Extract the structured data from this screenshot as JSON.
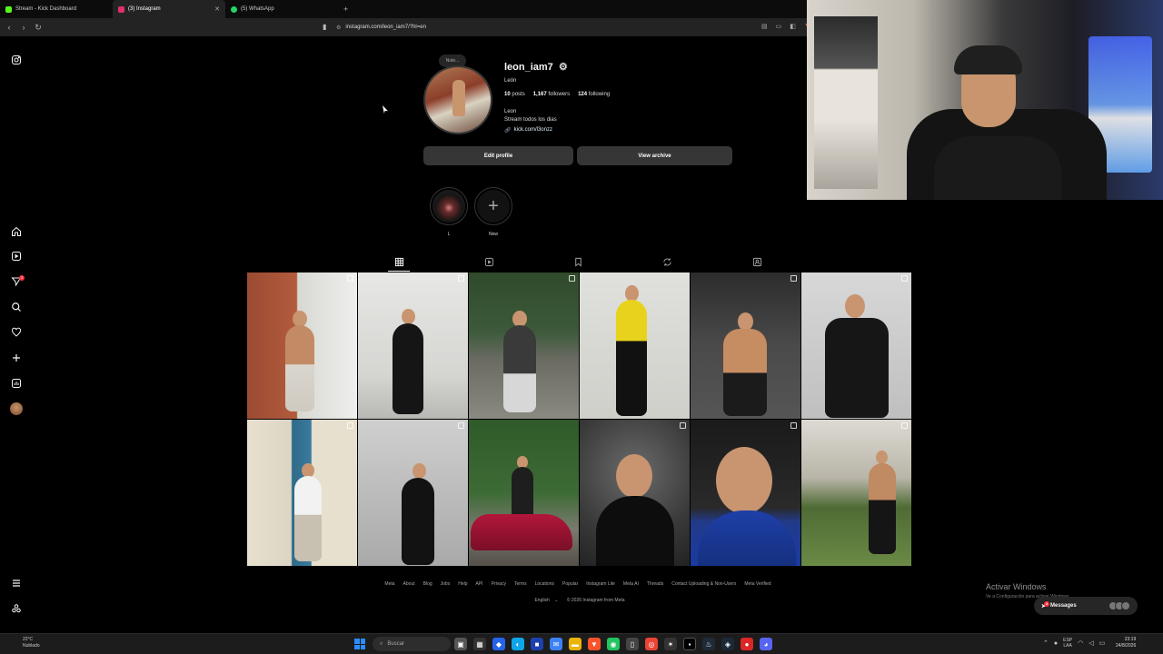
{
  "browser": {
    "tabs": [
      {
        "title": "Stream - Kick Dashboard",
        "color": "#53fc18"
      },
      {
        "title": "(3) Instagram",
        "color": "#e1306c"
      },
      {
        "title": "(5) WhatsApp",
        "color": "#25d366"
      }
    ],
    "url": "instagram.com/leon_iam7/?hl=en"
  },
  "sidebar": {
    "items": [
      "instagram-logo",
      "home",
      "reels",
      "messages",
      "search",
      "notifications",
      "create",
      "dashboard",
      "profile",
      "more",
      "also-from-meta"
    ],
    "messages_badge": "3"
  },
  "profile": {
    "note": "Note...",
    "username": "leon_iam7",
    "fullname": "León",
    "posts": "10",
    "posts_label": "posts",
    "followers": "1,167",
    "followers_label": "followers",
    "following": "124",
    "following_label": "following",
    "bio_name": "Leon",
    "bio_text": "Stream todos los dias",
    "link": "kick.com/l3onzz",
    "edit_button": "Edit profile",
    "archive_button": "View archive"
  },
  "highlights": [
    {
      "label": "L"
    },
    {
      "label": "New"
    }
  ],
  "tabs": [
    "posts",
    "reels",
    "saved",
    "reposts",
    "tagged"
  ],
  "footer": {
    "links": [
      "Meta",
      "About",
      "Blog",
      "Jobs",
      "Help",
      "API",
      "Privacy",
      "Terms",
      "Locations",
      "Popular",
      "Instagram Lite",
      "Meta AI",
      "Threads",
      "Contact Uploading & Non-Users",
      "Meta Verified"
    ],
    "language": "English",
    "copyright": "© 2026 Instagram from Meta"
  },
  "overlay": {
    "activate_title": "Activar Windows",
    "activate_sub": "Ve a Configuración para activar Windows.",
    "messages_label": "Messages",
    "messages_badge": "3"
  },
  "taskbar": {
    "temp": "22°C",
    "weather": "Nublado",
    "search_placeholder": "Buscar",
    "lang_top": "ESP",
    "lang_bottom": "LAA",
    "time": "23:19",
    "date": "24/8/2026"
  }
}
